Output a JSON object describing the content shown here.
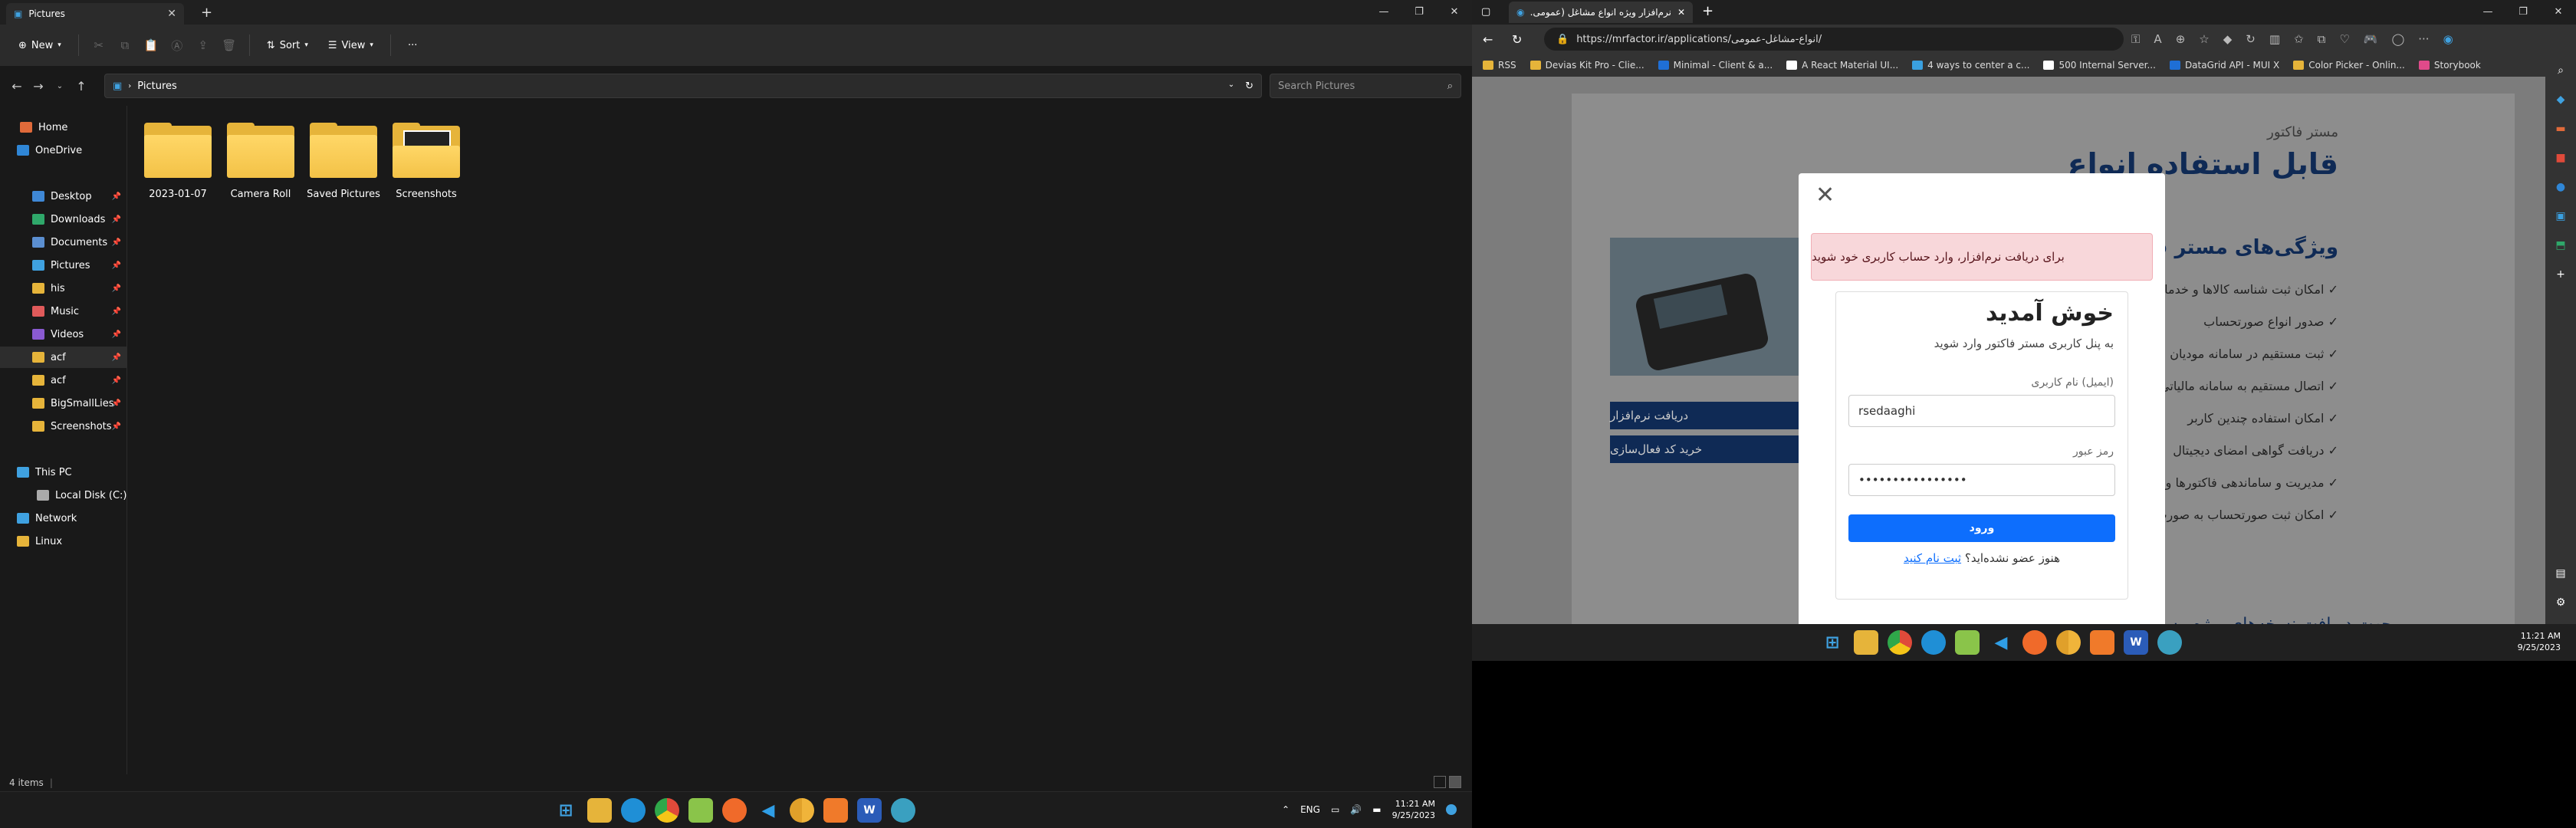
{
  "explorer": {
    "tab_title": "Pictures",
    "toolbar": {
      "new_label": "New",
      "sort_label": "Sort",
      "view_label": "View",
      "more": "···"
    },
    "address": {
      "path": "Pictures",
      "search_placeholder": "Search Pictures"
    },
    "nav": [
      {
        "label": "Home",
        "pin": false,
        "color": "#e06a3a"
      },
      {
        "label": "OneDrive",
        "pin": false,
        "color": "#2f86d6"
      },
      {
        "label": "Desktop",
        "pin": true,
        "color": "#3f88d6"
      },
      {
        "label": "Downloads",
        "pin": true,
        "color": "#2fa86a"
      },
      {
        "label": "Documents",
        "pin": true,
        "color": "#5b8fd1"
      },
      {
        "label": "Pictures",
        "pin": true,
        "color": "#3fa1e0"
      },
      {
        "label": "his",
        "pin": true,
        "color": "#e6b43a"
      },
      {
        "label": "Music",
        "pin": true,
        "color": "#e05a5a"
      },
      {
        "label": "Videos",
        "pin": true,
        "color": "#8a5ad1"
      },
      {
        "label": "acf",
        "pin": true,
        "color": "#e6b43a"
      },
      {
        "label": "acf",
        "pin": true,
        "color": "#e6b43a"
      },
      {
        "label": "BigSmallLies",
        "pin": true,
        "color": "#e6b43a"
      },
      {
        "label": "Screenshots",
        "pin": true,
        "color": "#e6b43a"
      },
      {
        "label": "This PC",
        "pin": false,
        "color": "#3fa1e0"
      },
      {
        "label": "Local Disk (C:)",
        "pin": false,
        "color": "#aaaaaa"
      },
      {
        "label": "Network",
        "pin": false,
        "color": "#3fa1e0"
      },
      {
        "label": "Linux",
        "pin": false,
        "color": "#e6b43a"
      }
    ],
    "folders": [
      "2023-01-07",
      "Camera Roll",
      "Saved Pictures",
      "Screenshots"
    ],
    "status": "4 items"
  },
  "taskbar_left": {
    "lang": "ENG",
    "time": "11:21 AM",
    "date": "9/25/2023"
  },
  "browser": {
    "tab_title": "نرم‌افزار ویژه انواع مشاغل (عمومی...",
    "url": "https://mrfactor.ir/applications/انواع-مشاغل-عمومی/",
    "bookmarks": [
      {
        "label": "RSS",
        "color": "#e6b43a"
      },
      {
        "label": "Devias Kit Pro - Clie...",
        "color": "#e6b43a"
      },
      {
        "label": "Minimal - Client & a...",
        "color": "#1f6fd6"
      },
      {
        "label": "A React Material UI...",
        "color": "#ffffff"
      },
      {
        "label": "4 ways to center a c...",
        "color": "#3aa0e0"
      },
      {
        "label": "500 Internal Server...",
        "color": "#ffffff"
      },
      {
        "label": "DataGrid API - MUI X",
        "color": "#1f6fd6"
      },
      {
        "label": "Color Picker - Onlin...",
        "color": "#e6b43a"
      },
      {
        "label": "Storybook",
        "color": "#e04a8a"
      }
    ],
    "page": {
      "small_title": "مستر فاکتور",
      "big_title": "قابل استفاده انواع",
      "features_title": "ویژگی‌های مستر فاکتور",
      "features": [
        "✓ امکان ثبت شناسه کالاها و خدمات توسط",
        "✓ صدور انواع صورتحساب",
        "✓ ثبت مستقیم در سامانه مودیان",
        "✓ اتصال مستقیم به سامانه مالیاتی",
        "✓ امکان استفاده چندین کاربر",
        "✓ دریافت گواهی امضای دیجیتال",
        "✓ مدیریت و ساماندهی فاکتورها و مشتری",
        "✓ امکان ثبت صورتحساب به صورت نقدی"
      ],
      "btn_download": "دریافت نرم‌افزار",
      "btn_buy": "خرید کد فعال‌سازی",
      "bottom_text": "جهت دریافت نسخه‌های ویژه مستر فاکتور، به صفحه نرم‌افزار"
    },
    "modal": {
      "close": "✕",
      "alert": "برای دریافت نرم‌افزار، وارد حساب کاربری خود شوید",
      "welcome": "خوش آمدید",
      "subtitle": "به پنل کاربری مستر فاکتور وارد شوید",
      "user_label": "(ایمیل) نام کاربری",
      "user_value": "rsedaaghi",
      "pass_label": "رمز عبور",
      "pass_value": "••••••••••••••••",
      "login_button": "ورود",
      "register_prompt": "هنوز عضو نشده‌اید؟",
      "register_link": "ثبت نام کنید"
    }
  },
  "taskbar_right": {
    "time": "11:21 AM",
    "date": "9/25/2023"
  }
}
